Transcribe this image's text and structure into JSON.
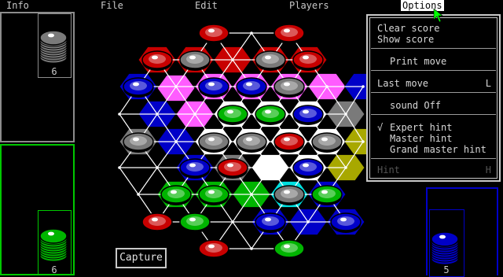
{
  "menubar": {
    "items": [
      {
        "label": "Info"
      },
      {
        "label": "File"
      },
      {
        "label": "Edit"
      },
      {
        "label": "Players"
      },
      {
        "label": "Options"
      }
    ]
  },
  "options_menu": {
    "clear_score": "Clear score",
    "show_score": "Show score",
    "print_move": "Print move",
    "last_move": "Last move",
    "last_move_shortcut": "L",
    "sound": "sound Off",
    "expert_hint": "Expert hint",
    "expert_check": "√",
    "master_hint": "Master hint",
    "grand_master_hint": "Grand master hint",
    "hint": "Hint",
    "hint_shortcut": "H"
  },
  "players": {
    "gray": {
      "count": "6",
      "color": "#8c8c8c"
    },
    "green": {
      "count": "6",
      "color": "#00c800"
    },
    "blue": {
      "count": "5",
      "color": "#0000c8"
    }
  },
  "capture_button": "Capture",
  "colors": {
    "red": "#c80000",
    "gray": "#7a7a7a",
    "blue": "#0000c8",
    "green": "#00b400",
    "magenta": "#ff5cff",
    "yellow": "#a8a800",
    "cyan": "#00e0e0",
    "white": "#ffffff"
  }
}
